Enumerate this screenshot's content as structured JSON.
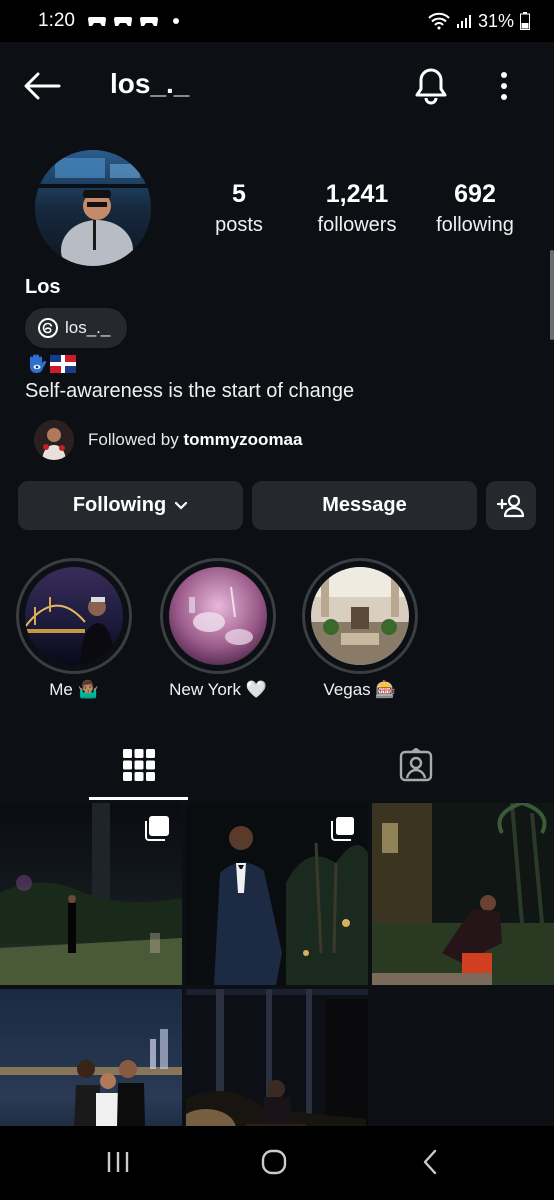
{
  "status_bar": {
    "time": "1:20",
    "battery": "31%"
  },
  "header": {
    "username": "los_._"
  },
  "profile": {
    "posts_count": "5",
    "posts_label": "posts",
    "followers_count": "1,241",
    "followers_label": "followers",
    "following_count": "692",
    "following_label": "following",
    "display_name": "Los",
    "threads_handle": "los_._",
    "bio": "Self-awareness is the start of change",
    "followed_by_prefix": "Followed by ",
    "followed_by_user": "tommyzoomaa"
  },
  "actions": {
    "following_label": "Following",
    "message_label": "Message"
  },
  "highlights": [
    {
      "label": "Me 🤷🏽‍♂️"
    },
    {
      "label": "New York 🤍"
    },
    {
      "label": "Vegas 🎰"
    }
  ],
  "tabs": [
    {
      "icon": "grid-icon"
    },
    {
      "icon": "tagged-icon"
    }
  ],
  "colors": {
    "background": "#0c1014",
    "button": "#25292e",
    "text": "#f5f5f5"
  }
}
